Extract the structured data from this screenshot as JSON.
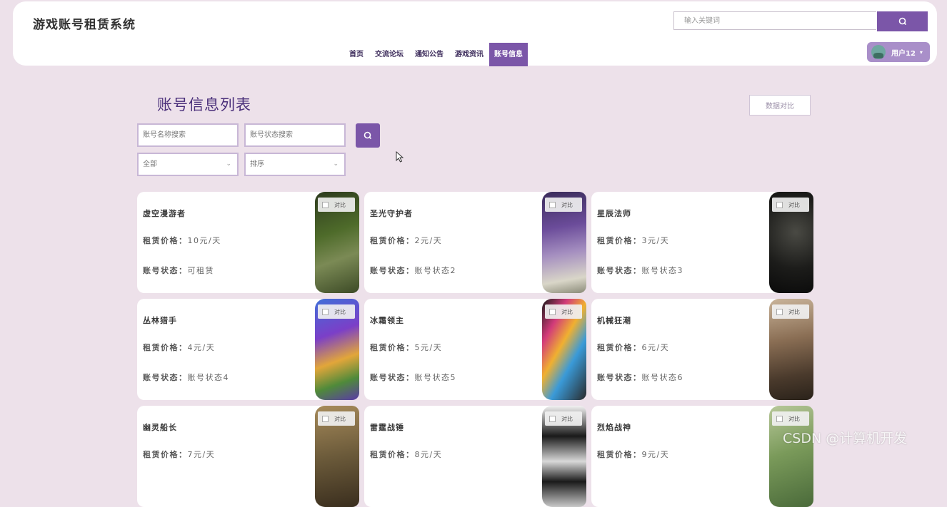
{
  "site": {
    "title": "游戏账号租赁系统"
  },
  "search": {
    "placeholder": "输入关键词"
  },
  "nav": [
    {
      "label": "首页"
    },
    {
      "label": "交流论坛"
    },
    {
      "label": "通知公告"
    },
    {
      "label": "游戏资讯"
    },
    {
      "label": "账号信息",
      "active": true
    }
  ],
  "user": {
    "name": "用户12"
  },
  "page": {
    "title": "账号信息列表",
    "compare_label": "数据对比"
  },
  "filters": {
    "name_placeholder": "账号名称搜索",
    "status_placeholder": "账号状态搜索",
    "category_value": "全部",
    "sort_value": "排序"
  },
  "card_labels": {
    "price": "租赁价格：",
    "status": "账号状态：",
    "compare": "对比"
  },
  "cards": [
    {
      "name": "虚空漫游者",
      "price": "10元/天",
      "status": "可租赁"
    },
    {
      "name": "圣光守护者",
      "price": "2元/天",
      "status": "账号状态2"
    },
    {
      "name": "星辰法师",
      "price": "3元/天",
      "status": "账号状态3"
    },
    {
      "name": "丛林猎手",
      "price": "4元/天",
      "status": "账号状态4"
    },
    {
      "name": "冰霜领主",
      "price": "5元/天",
      "status": "账号状态5"
    },
    {
      "name": "机械狂潮",
      "price": "6元/天",
      "status": "账号状态6"
    },
    {
      "name": "幽灵船长",
      "price": "7元/天",
      "status": ""
    },
    {
      "name": "雷霆战锤",
      "price": "8元/天",
      "status": ""
    },
    {
      "name": "烈焰战神",
      "price": "9元/天",
      "status": ""
    }
  ],
  "watermark": "CSDN @计算机开发",
  "colors": {
    "accent": "#7b56a8",
    "background": "#ede1ea",
    "title": "#4a2f7a"
  },
  "icons": {
    "search": "search-icon",
    "user_menu": "chevron-down-icon"
  }
}
